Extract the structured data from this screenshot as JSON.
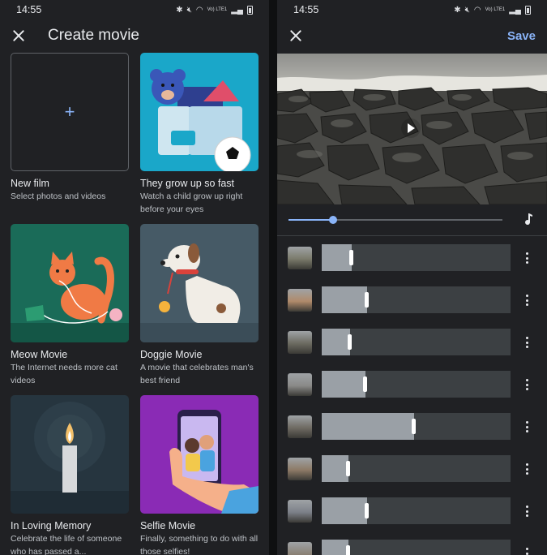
{
  "status": {
    "time": "14:55",
    "network_label": "Vo) LTE1"
  },
  "left": {
    "title": "Create movie",
    "cards": [
      {
        "title": "New film",
        "subtitle": "Select photos and videos"
      },
      {
        "title": "They grow up so fast",
        "subtitle": "Watch a child grow up right before your eyes"
      },
      {
        "title": "Meow Movie",
        "subtitle": "The Internet needs more cat videos"
      },
      {
        "title": "Doggie Movie",
        "subtitle": "A movie that celebrates man's best friend"
      },
      {
        "title": "In Loving Memory",
        "subtitle": "Celebrate the life of someone who has passed a..."
      },
      {
        "title": "Selfie Movie",
        "subtitle": "Finally, something to do with all those selfies!"
      }
    ]
  },
  "right": {
    "save_label": "Save",
    "scrubber_progress": 0.21,
    "clips": [
      {
        "thumb": "#7a7a6a",
        "fill": 0.16
      },
      {
        "thumb": "#b08a6a",
        "fill": 0.24
      },
      {
        "thumb": "#6b6a60",
        "fill": 0.15
      },
      {
        "thumb": "#8a8a88",
        "fill": 0.23
      },
      {
        "thumb": "#6e6a62",
        "fill": 0.49
      },
      {
        "thumb": "#8d7a66",
        "fill": 0.14
      },
      {
        "thumb": "#7c8088",
        "fill": 0.24
      },
      {
        "thumb": "#8a8074",
        "fill": 0.14
      }
    ]
  }
}
